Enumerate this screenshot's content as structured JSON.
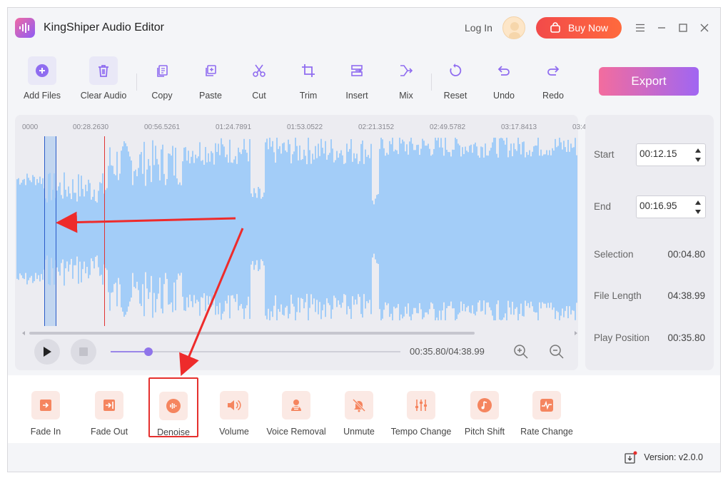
{
  "app": {
    "title": "KingShiper Audio Editor",
    "login": "Log In",
    "buy_now": "Buy Now"
  },
  "toolbar": {
    "add_files": "Add Files",
    "clear_audio": "Clear Audio",
    "copy": "Copy",
    "paste": "Paste",
    "cut": "Cut",
    "trim": "Trim",
    "insert": "Insert",
    "mix": "Mix",
    "reset": "Reset",
    "undo": "Undo",
    "redo": "Redo",
    "export": "Export"
  },
  "ruler": [
    "0000",
    "00:28.2630",
    "00:56.5261",
    "01:24.7891",
    "01:53.0522",
    "02:21.3152",
    "02:49.5782",
    "03:17.8413",
    "03:4"
  ],
  "player": {
    "time": "00:35.80/04:38.99",
    "progress": 0.13
  },
  "side": {
    "start_label": "Start",
    "start_value": "00:12.15",
    "end_label": "End",
    "end_value": "00:16.95",
    "selection_label": "Selection",
    "selection_value": "00:04.80",
    "file_length_label": "File Length",
    "file_length_value": "04:38.99",
    "play_position_label": "Play Position",
    "play_position_value": "00:35.80"
  },
  "effects": {
    "fade_in": "Fade In",
    "fade_out": "Fade Out",
    "denoise": "Denoise",
    "volume": "Volume",
    "voice_removal": "Voice Removal",
    "unmute": "Unmute",
    "tempo_change": "Tempo Change",
    "pitch_shift": "Pitch Shift",
    "rate_change": "Rate Change"
  },
  "status": {
    "version": "Version: v2.0.0"
  },
  "colors": {
    "accent": "#8f74ea",
    "wave": "#a3cdf8",
    "buy": "#f24a4a",
    "highlight": "#e5302e"
  }
}
